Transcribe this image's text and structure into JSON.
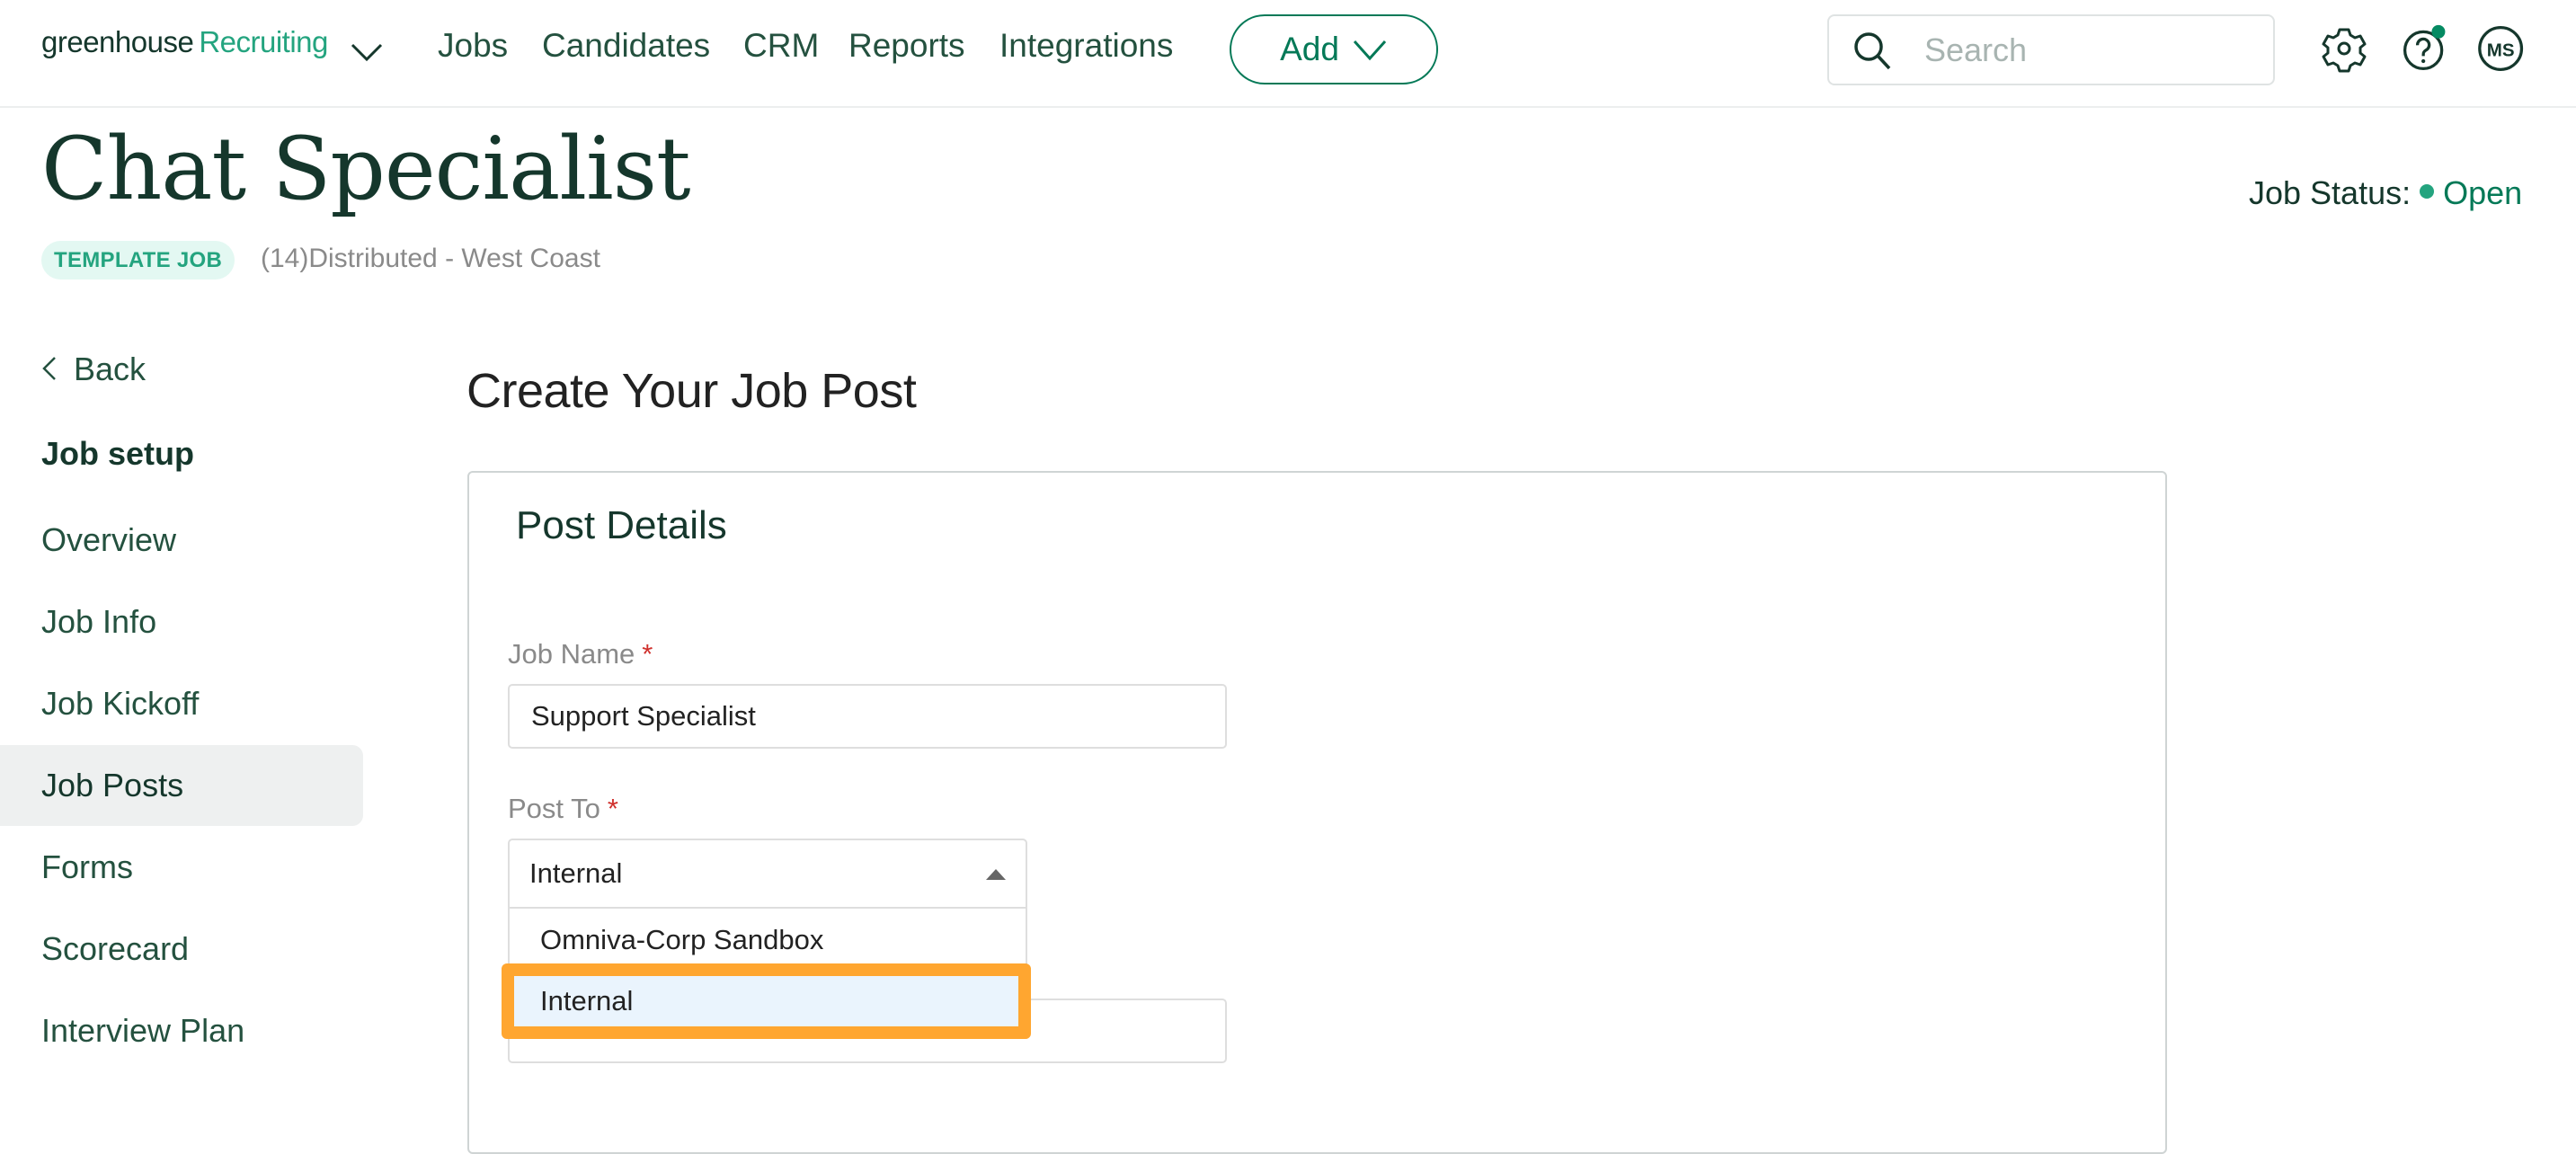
{
  "header": {
    "logo_primary": "greenhouse",
    "logo_secondary": "Recruiting",
    "nav": [
      "Jobs",
      "Candidates",
      "CRM",
      "Reports",
      "Integrations"
    ],
    "add_label": "Add",
    "search_placeholder": "Search",
    "avatar_initials": "MS",
    "icons": [
      "chevron-down-icon",
      "search-icon",
      "gear-icon",
      "help-icon",
      "notification-dot"
    ]
  },
  "job": {
    "title": "Chat Specialist",
    "badge": "TEMPLATE JOB",
    "location": "(14)Distributed - West Coast",
    "status_label": "Job Status:",
    "status_value": "Open"
  },
  "sidebar": {
    "back_label": "Back",
    "section_heading": "Job setup",
    "items": [
      {
        "label": "Overview",
        "active": false
      },
      {
        "label": "Job Info",
        "active": false
      },
      {
        "label": "Job Kickoff",
        "active": false
      },
      {
        "label": "Job Posts",
        "active": true
      },
      {
        "label": "Forms",
        "active": false
      },
      {
        "label": "Scorecard",
        "active": false
      },
      {
        "label": "Interview Plan",
        "active": false
      }
    ]
  },
  "main": {
    "heading": "Create Your Job Post",
    "card_title": "Post Details",
    "job_name": {
      "label": "Job Name",
      "required_mark": "*",
      "value": "Support Specialist"
    },
    "post_to": {
      "label": "Post To",
      "required_mark": "*",
      "selected": "Internal",
      "options": [
        "Omniva-Corp Sandbox",
        "Internal"
      ],
      "highlighted_option": "Internal"
    }
  },
  "colors": {
    "brand_dark": "#15372c",
    "brand_green": "#24a47f",
    "button_green": "#047957",
    "highlight_orange": "#ffa630",
    "option_hover": "#eaf4fd"
  }
}
